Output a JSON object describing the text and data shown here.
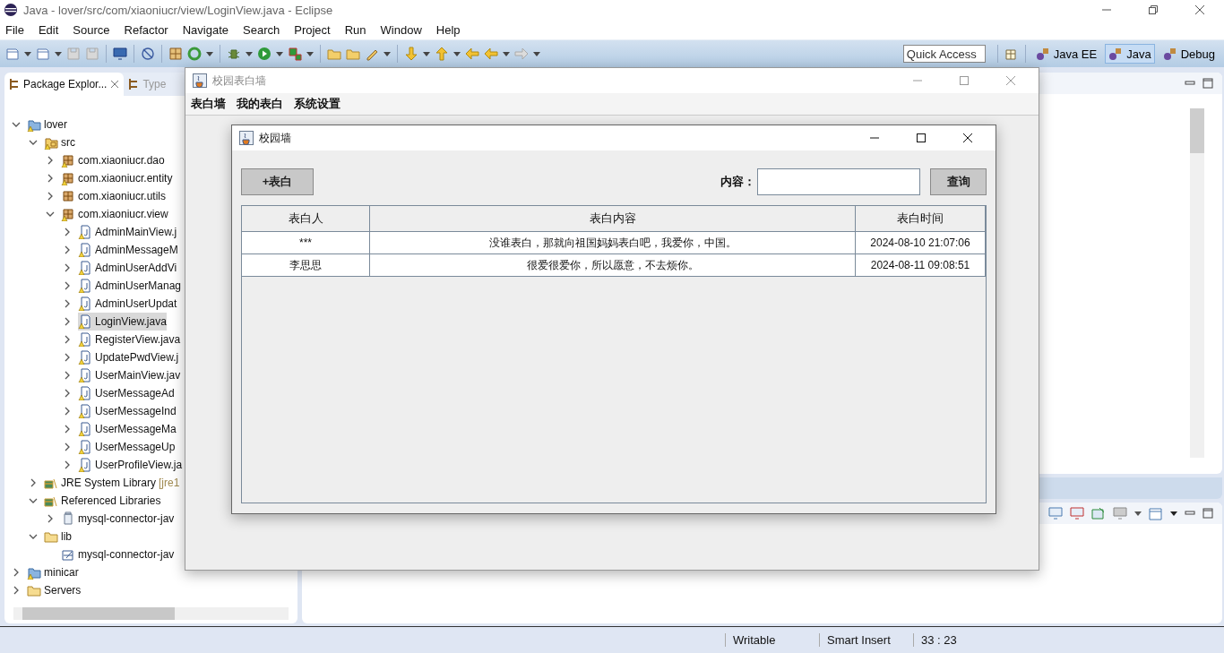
{
  "window": {
    "title": "Java - lover/src/com/xiaoniucr/view/LoginView.java - Eclipse"
  },
  "menu": [
    "File",
    "Edit",
    "Source",
    "Refactor",
    "Navigate",
    "Search",
    "Project",
    "Run",
    "Window",
    "Help"
  ],
  "quick_access": {
    "placeholder": "Quick Access"
  },
  "perspectives": [
    {
      "label": "Java EE",
      "selected": false
    },
    {
      "label": "Java",
      "selected": true
    },
    {
      "label": "Debug",
      "selected": false
    }
  ],
  "package_explorer": {
    "tabs": [
      {
        "label": "Package Explor...",
        "selected": true
      },
      {
        "label": "Type",
        "selected": false
      }
    ],
    "tree": [
      {
        "label": "lover",
        "kind": "project",
        "warning": true,
        "expanded": true,
        "selected": false,
        "children": [
          {
            "label": "src",
            "kind": "source-folder",
            "warning": true,
            "expanded": true,
            "selected": false,
            "children": [
              {
                "label": "com.xiaoniucr.dao",
                "kind": "package",
                "warning": true,
                "expanded": false,
                "selected": false
              },
              {
                "label": "com.xiaoniucr.entity",
                "kind": "package",
                "warning": true,
                "expanded": false,
                "selected": false
              },
              {
                "label": "com.xiaoniucr.utils",
                "kind": "package",
                "warning": false,
                "expanded": false,
                "selected": false
              },
              {
                "label": "com.xiaoniucr.view",
                "kind": "package",
                "warning": true,
                "expanded": true,
                "selected": false,
                "children": [
                  {
                    "label": "AdminMainView.j",
                    "kind": "java-file",
                    "warning": true,
                    "expanded": false,
                    "selected": false
                  },
                  {
                    "label": "AdminMessageM",
                    "kind": "java-file",
                    "warning": true,
                    "expanded": false,
                    "selected": false
                  },
                  {
                    "label": "AdminUserAddVi",
                    "kind": "java-file",
                    "warning": true,
                    "expanded": false,
                    "selected": false
                  },
                  {
                    "label": "AdminUserManag",
                    "kind": "java-file",
                    "warning": true,
                    "expanded": false,
                    "selected": false
                  },
                  {
                    "label": "AdminUserUpdat",
                    "kind": "java-file",
                    "warning": true,
                    "expanded": false,
                    "selected": false
                  },
                  {
                    "label": "LoginView.java",
                    "kind": "java-file",
                    "warning": true,
                    "expanded": false,
                    "selected": true
                  },
                  {
                    "label": "RegisterView.java",
                    "kind": "java-file",
                    "warning": true,
                    "expanded": false,
                    "selected": false
                  },
                  {
                    "label": "UpdatePwdView.j",
                    "kind": "java-file",
                    "warning": true,
                    "expanded": false,
                    "selected": false
                  },
                  {
                    "label": "UserMainView.jav",
                    "kind": "java-file",
                    "warning": true,
                    "expanded": false,
                    "selected": false
                  },
                  {
                    "label": "UserMessageAd",
                    "kind": "java-file",
                    "warning": true,
                    "expanded": false,
                    "selected": false
                  },
                  {
                    "label": "UserMessageInd",
                    "kind": "java-file",
                    "warning": true,
                    "expanded": false,
                    "selected": false
                  },
                  {
                    "label": "UserMessageMa",
                    "kind": "java-file",
                    "warning": true,
                    "expanded": false,
                    "selected": false
                  },
                  {
                    "label": "UserMessageUp",
                    "kind": "java-file",
                    "warning": true,
                    "expanded": false,
                    "selected": false
                  },
                  {
                    "label": "UserProfileView.ja",
                    "kind": "java-file",
                    "warning": true,
                    "expanded": false,
                    "selected": false
                  }
                ]
              }
            ]
          },
          {
            "label": "JRE System Library",
            "decoration": "[jre1",
            "kind": "library",
            "warning": false,
            "expanded": false,
            "selected": false
          },
          {
            "label": "Referenced Libraries",
            "kind": "library",
            "warning": false,
            "expanded": true,
            "selected": false,
            "children": [
              {
                "label": "mysql-connector-jav",
                "kind": "jar",
                "warning": false,
                "expanded": false,
                "selected": false
              }
            ]
          },
          {
            "label": "lib",
            "kind": "folder",
            "warning": false,
            "expanded": true,
            "selected": false,
            "children": [
              {
                "label": "mysql-connector-jav",
                "kind": "jar-file",
                "warning": false,
                "expandable": false,
                "selected": false
              }
            ]
          }
        ]
      },
      {
        "label": "minicar",
        "kind": "project",
        "warning": true,
        "expanded": false,
        "selected": false
      },
      {
        "label": "Servers",
        "kind": "folder",
        "warning": false,
        "expanded": false,
        "selected": false
      }
    ]
  },
  "status_bar": [
    "Writable",
    "Smart Insert",
    "33 : 23"
  ],
  "app_window": {
    "title": "校园表白墙",
    "menu": [
      "表白墙",
      "我的表白",
      "系统设置"
    ]
  },
  "dialog": {
    "title": "校园墙",
    "add_button": "+表白",
    "search_label": "内容：",
    "search_button": "查询",
    "table": {
      "columns": [
        "表白人",
        "表白内容",
        "表白时间"
      ],
      "rows": [
        [
          "***",
          "没谁表白，那就向祖国妈妈表白吧，我爱你，中国。",
          "2024-08-10 21:07:06"
        ],
        [
          "李思思",
          "很爱很爱你，所以愿意，不去烦你。",
          "2024-08-11 09:08:51"
        ]
      ]
    }
  }
}
